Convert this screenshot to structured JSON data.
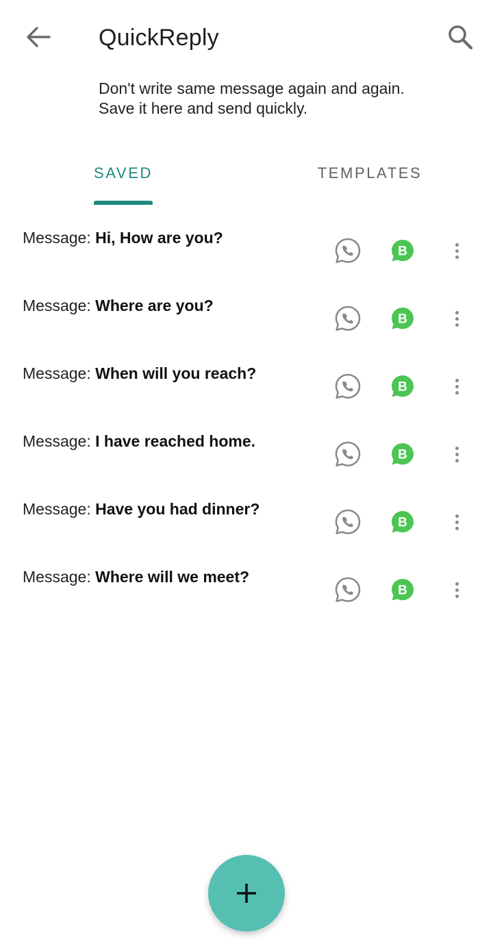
{
  "header": {
    "title": "QuickReply",
    "back_icon": "arrow-left-icon",
    "search_icon": "search-icon"
  },
  "subtitle": {
    "line1": "Don't write same message again and again.",
    "line2": "Save it here and send quickly."
  },
  "tabs": [
    {
      "label": "SAVED",
      "active": true
    },
    {
      "label": "TEMPLATES",
      "active": false
    }
  ],
  "messages": [
    {
      "label": "Message: ",
      "text": "Hi, How are you?"
    },
    {
      "label": "Message: ",
      "text": "Where are you?"
    },
    {
      "label": "Message: ",
      "text": "When will you reach?"
    },
    {
      "label": "Message: ",
      "text": "I have reached home."
    },
    {
      "label": "Message: ",
      "text": "Have you had dinner?"
    },
    {
      "label": "Message: ",
      "text": "Where will we meet?"
    }
  ],
  "row_actions": {
    "whatsapp_icon": "whatsapp-icon",
    "business_icon": "whatsapp-business-icon",
    "more_icon": "more-vert-icon",
    "business_letter": "B"
  },
  "fab": {
    "icon": "plus-icon"
  },
  "colors": {
    "accent": "#1e8a7e",
    "fab": "#55bfb2",
    "whatsapp_gray": "#8a8a8a",
    "business_green": "#4cc553"
  }
}
